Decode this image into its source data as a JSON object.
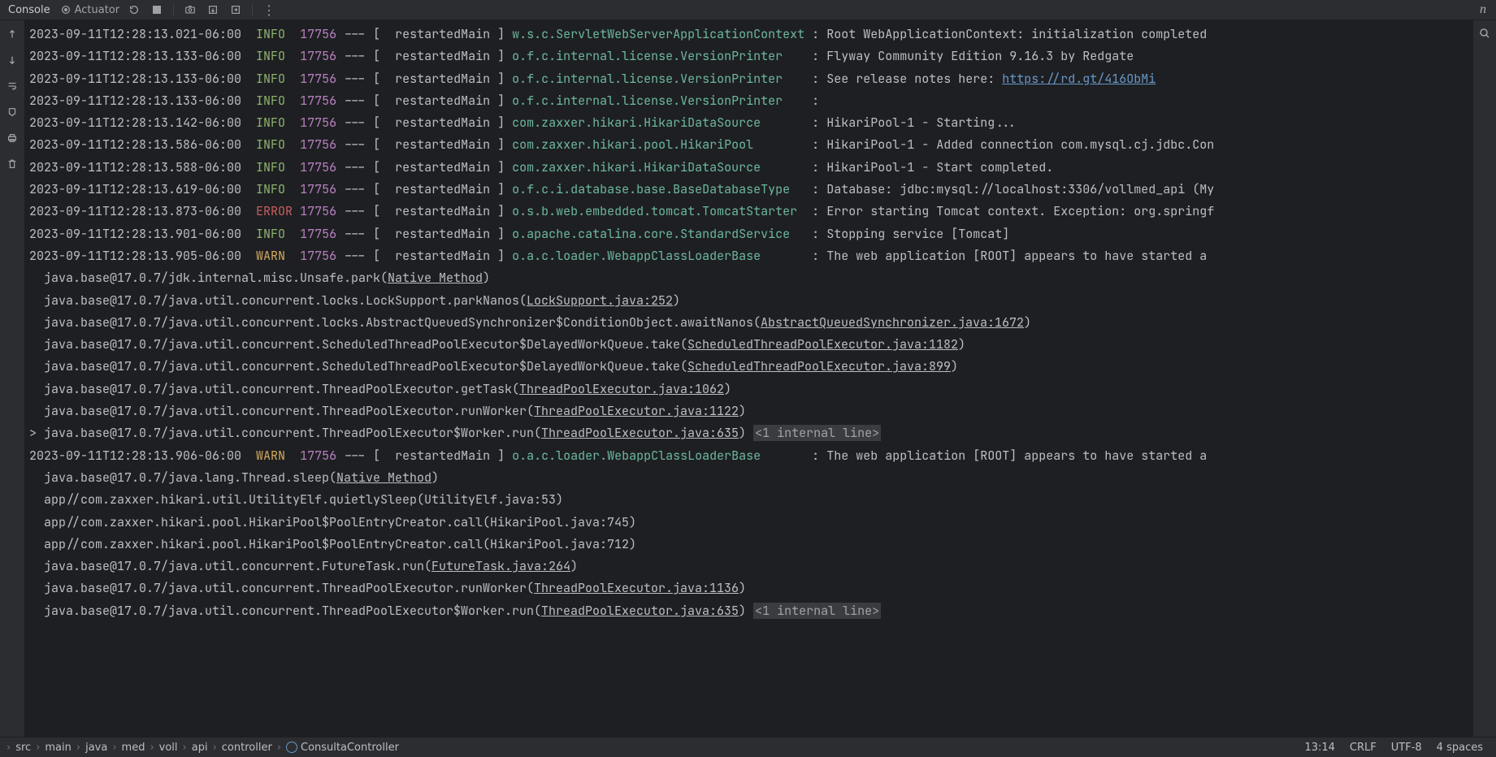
{
  "toolbar": {
    "console_label": "Console",
    "actuator_label": "Actuator"
  },
  "log_lines": [
    {
      "ts": "2023-09-11T12:28:13.021-06:00",
      "lvl": "INFO",
      "pid": "17756",
      "thread": "restartedMain",
      "logger": "w.s.c.ServletWebServerApplicationContext",
      "msg": "Root WebApplicationContext: initialization completed"
    },
    {
      "ts": "2023-09-11T12:28:13.133-06:00",
      "lvl": "INFO",
      "pid": "17756",
      "thread": "restartedMain",
      "logger": "o.f.c.internal.license.VersionPrinter",
      "msg": "Flyway Community Edition 9.16.3 by Redgate"
    },
    {
      "ts": "2023-09-11T12:28:13.133-06:00",
      "lvl": "INFO",
      "pid": "17756",
      "thread": "restartedMain",
      "logger": "o.f.c.internal.license.VersionPrinter",
      "msg": "See release notes here: ",
      "link": "https://rd.gt/416ObMi"
    },
    {
      "ts": "2023-09-11T12:28:13.133-06:00",
      "lvl": "INFO",
      "pid": "17756",
      "thread": "restartedMain",
      "logger": "o.f.c.internal.license.VersionPrinter",
      "msg": ""
    },
    {
      "ts": "2023-09-11T12:28:13.142-06:00",
      "lvl": "INFO",
      "pid": "17756",
      "thread": "restartedMain",
      "logger": "com.zaxxer.hikari.HikariDataSource",
      "msg": "HikariPool-1 - Starting..."
    },
    {
      "ts": "2023-09-11T12:28:13.586-06:00",
      "lvl": "INFO",
      "pid": "17756",
      "thread": "restartedMain",
      "logger": "com.zaxxer.hikari.pool.HikariPool",
      "msg": "HikariPool-1 - Added connection com.mysql.cj.jdbc.Con"
    },
    {
      "ts": "2023-09-11T12:28:13.588-06:00",
      "lvl": "INFO",
      "pid": "17756",
      "thread": "restartedMain",
      "logger": "com.zaxxer.hikari.HikariDataSource",
      "msg": "HikariPool-1 - Start completed."
    },
    {
      "ts": "2023-09-11T12:28:13.619-06:00",
      "lvl": "INFO",
      "pid": "17756",
      "thread": "restartedMain",
      "logger": "o.f.c.i.database.base.BaseDatabaseType",
      "msg": "Database: jdbc:mysql://localhost:3306/vollmed_api (My"
    },
    {
      "ts": "2023-09-11T12:28:13.873-06:00",
      "lvl": "ERROR",
      "pid": "17756",
      "thread": "restartedMain",
      "logger": "o.s.b.web.embedded.tomcat.TomcatStarter",
      "msg": "Error starting Tomcat context. Exception: org.springf"
    },
    {
      "ts": "2023-09-11T12:28:13.901-06:00",
      "lvl": "INFO",
      "pid": "17756",
      "thread": "restartedMain",
      "logger": "o.apache.catalina.core.StandardService",
      "msg": "Stopping service [Tomcat]"
    },
    {
      "ts": "2023-09-11T12:28:13.905-06:00",
      "lvl": "WARN",
      "pid": "17756",
      "thread": "restartedMain",
      "logger": "o.a.c.loader.WebappClassLoaderBase",
      "msg": "The web application [ROOT] appears to have started a"
    }
  ],
  "stack1": [
    {
      "pre": " java.base@17.0.7/jdk.internal.misc.Unsafe.park(",
      "link": "Native Method",
      "post": ")"
    },
    {
      "pre": " java.base@17.0.7/java.util.concurrent.locks.LockSupport.parkNanos(",
      "link": "LockSupport.java:252",
      "post": ")"
    },
    {
      "pre": " java.base@17.0.7/java.util.concurrent.locks.AbstractQueuedSynchronizer$ConditionObject.awaitNanos(",
      "link": "AbstractQueuedSynchronizer.java:1672",
      "post": ")"
    },
    {
      "pre": " java.base@17.0.7/java.util.concurrent.ScheduledThreadPoolExecutor$DelayedWorkQueue.take(",
      "link": "ScheduledThreadPoolExecutor.java:1182",
      "post": ")"
    },
    {
      "pre": " java.base@17.0.7/java.util.concurrent.ScheduledThreadPoolExecutor$DelayedWorkQueue.take(",
      "link": "ScheduledThreadPoolExecutor.java:899",
      "post": ")"
    },
    {
      "pre": " java.base@17.0.7/java.util.concurrent.ThreadPoolExecutor.getTask(",
      "link": "ThreadPoolExecutor.java:1062",
      "post": ")"
    },
    {
      "pre": " java.base@17.0.7/java.util.concurrent.ThreadPoolExecutor.runWorker(",
      "link": "ThreadPoolExecutor.java:1122",
      "post": ")"
    },
    {
      "pre": " java.base@17.0.7/java.util.concurrent.ThreadPoolExecutor$Worker.run(",
      "link": "ThreadPoolExecutor.java:635",
      "post": ")",
      "internal": "<1 internal line>",
      "expand": true
    }
  ],
  "log_lines2": [
    {
      "ts": "2023-09-11T12:28:13.906-06:00",
      "lvl": "WARN",
      "pid": "17756",
      "thread": "restartedMain",
      "logger": "o.a.c.loader.WebappClassLoaderBase",
      "msg": "The web application [ROOT] appears to have started a"
    }
  ],
  "stack2": [
    {
      "pre": " java.base@17.0.7/java.lang.Thread.sleep(",
      "link": "Native Method",
      "post": ")"
    },
    {
      "pre": " app//com.zaxxer.hikari.util.UtilityElf.quietlySleep(UtilityElf.java:53)",
      "plain": true
    },
    {
      "pre": " app//com.zaxxer.hikari.pool.HikariPool$PoolEntryCreator.call(HikariPool.java:745)",
      "plain": true
    },
    {
      "pre": " app//com.zaxxer.hikari.pool.HikariPool$PoolEntryCreator.call(HikariPool.java:712)",
      "plain": true
    },
    {
      "pre": " java.base@17.0.7/java.util.concurrent.FutureTask.run(",
      "link": "FutureTask.java:264",
      "post": ")"
    },
    {
      "pre": " java.base@17.0.7/java.util.concurrent.ThreadPoolExecutor.runWorker(",
      "link": "ThreadPoolExecutor.java:1136",
      "post": ")"
    }
  ],
  "fade_line": {
    "pre": " java.base@17.0.7/java.util.concurrent.ThreadPoolExecutor$Worker.run(",
    "link": "ThreadPoolExecutor.java:635",
    "post": ")",
    "internal": "<1 internal line>"
  },
  "breadcrumb": [
    "src",
    "main",
    "java",
    "med",
    "voll",
    "api",
    "controller"
  ],
  "breadcrumb_leaf": "ConsultaController",
  "status": {
    "pos": "13:14",
    "eol": "CRLF",
    "enc": "UTF-8",
    "indent": "4 spaces"
  }
}
